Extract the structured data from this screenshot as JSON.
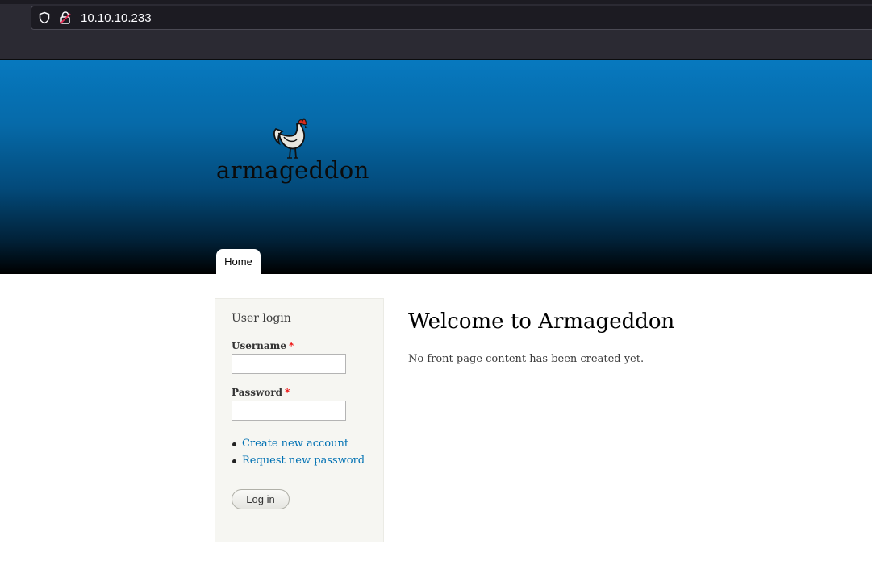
{
  "browser": {
    "url": "10.10.10.233",
    "icons": [
      "shield-icon",
      "lock-icon"
    ]
  },
  "header": {
    "logo_text": "armageddon",
    "logo_icon": "rooster-icon",
    "nav_tabs": [
      {
        "label": "Home",
        "active": true
      }
    ],
    "gradient_colors": [
      "#0779bf",
      "#000000"
    ]
  },
  "login": {
    "title": "User login",
    "username_label": "Username",
    "password_label": "Password",
    "required_marker": "*",
    "username_value": "",
    "password_value": "",
    "links": [
      {
        "label": "Create new account"
      },
      {
        "label": "Request new password"
      }
    ],
    "submit_label": "Log in"
  },
  "main": {
    "title": "Welcome to Armageddon",
    "body": "No front page content has been created yet."
  },
  "colors": {
    "link": "#0071b3",
    "required": "#ee0000",
    "sidebar_bg": "#f6f6f2"
  }
}
